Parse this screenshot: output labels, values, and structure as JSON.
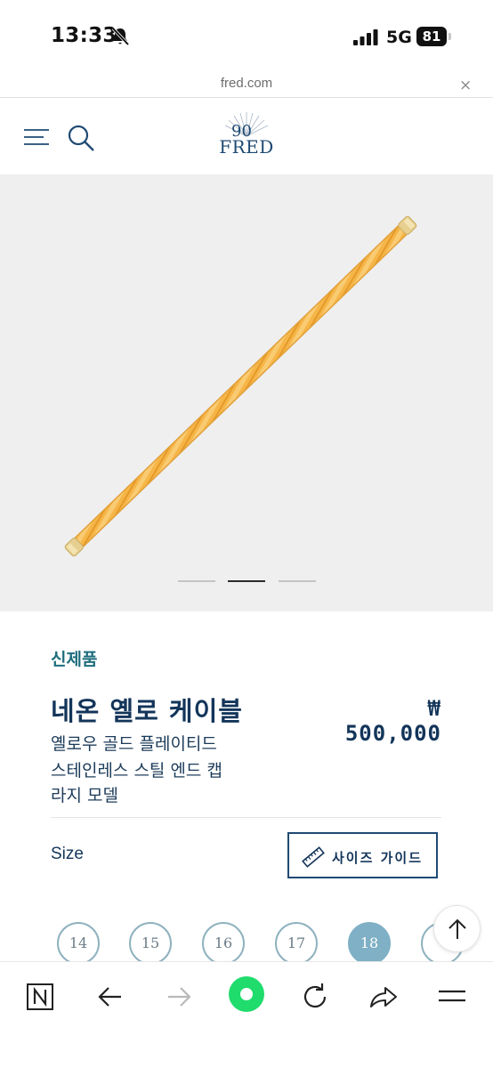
{
  "status_bar": {
    "time": "13:33",
    "network": "5G",
    "battery": "81"
  },
  "browser": {
    "url": "fred.com",
    "close_symbol": "×"
  },
  "header": {
    "logo_text": "FRED",
    "icons": [
      "menu-icon",
      "search-icon"
    ]
  },
  "gallery": {
    "slide_count": 3,
    "active_slide": 2
  },
  "product": {
    "badge": "신제품",
    "name": "네온 옐로 케이블",
    "price": "₩ 500,000",
    "description_lines": [
      "옐로우 골드 플레이티드",
      "스테인레스 스틸 엔드 캡",
      "라지 모델"
    ]
  },
  "size": {
    "label": "Size",
    "guide_button": "사이즈 가이드",
    "options": [
      "14",
      "15",
      "16",
      "17",
      "18"
    ],
    "selected": "18"
  },
  "colors": {
    "navy": "#13355a",
    "teal": "#1e6d7d",
    "selected_chip": "#7fb0c5",
    "bracelet": "#f6b547",
    "green_button": "#1fdc6c"
  }
}
